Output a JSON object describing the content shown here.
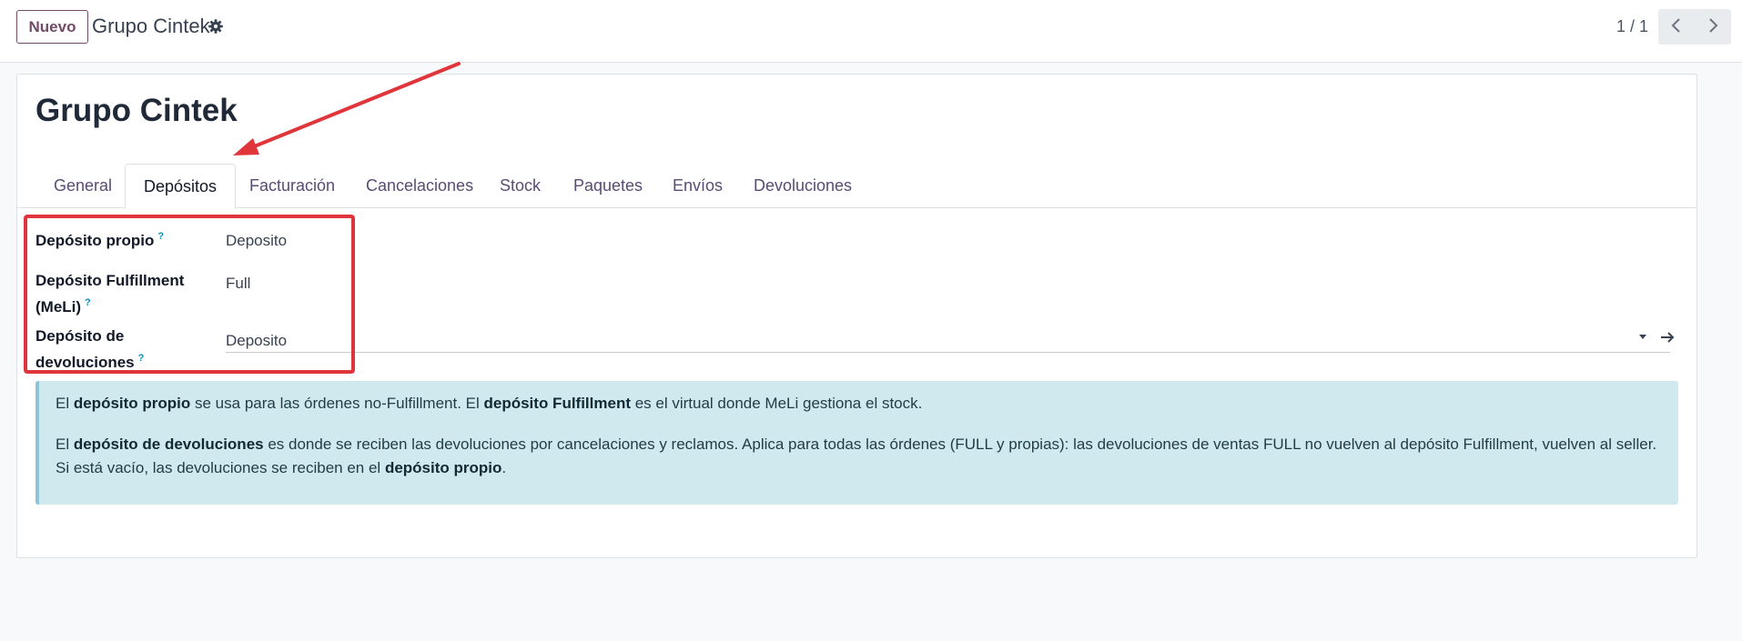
{
  "control_panel": {
    "new_button": "Nuevo",
    "breadcrumb": "Grupo Cintek",
    "pager": "1 / 1"
  },
  "record": {
    "title": "Grupo Cintek"
  },
  "tabs": [
    {
      "label": "General",
      "active": false
    },
    {
      "label": "Depósitos",
      "active": true
    },
    {
      "label": "Facturación",
      "active": false
    },
    {
      "label": "Cancelaciones",
      "active": false
    },
    {
      "label": "Stock",
      "active": false
    },
    {
      "label": "Paquetes",
      "active": false
    },
    {
      "label": "Envíos",
      "active": false
    },
    {
      "label": "Devoluciones",
      "active": false
    }
  ],
  "fields": {
    "own_depot": {
      "label": "Depósito propio",
      "help": "?",
      "value": "Deposito"
    },
    "fulfillment_depot": {
      "label_line1": "Depósito Fulfillment",
      "label_line2": "(MeLi)",
      "help": "?",
      "value": "Full"
    },
    "returns_depot": {
      "label_line1": "Depósito de",
      "label_line2": "devoluciones",
      "help": "?",
      "value": "Deposito"
    }
  },
  "info": {
    "p1": {
      "t1": "El ",
      "b1": "depósito propio",
      "t2": " se usa para las órdenes no-Fulfillment. El ",
      "b2": "depósito Fulfillment",
      "t3": " es el virtual donde MeLi gestiona el stock."
    },
    "p2": {
      "t1": "El ",
      "b1": "depósito de devoluciones",
      "t2": " es donde se reciben las devoluciones por cancelaciones y reclamos. Aplica para todas las órdenes (FULL y propias): las devoluciones de ventas FULL no vuelven al depósito Fulfillment, vuelven al seller. Si está vacío, las devoluciones se reciben en el ",
      "b2": "depósito propio",
      "t3": "."
    }
  },
  "colors": {
    "accent": "#714b67",
    "annotation": "#e0353b",
    "info_bg": "#cfe9ef",
    "help": "#0d8fbd"
  },
  "icons": [
    "gear-icon",
    "chevron-left-icon",
    "chevron-right-icon",
    "caret-down-icon",
    "arrow-right-icon"
  ]
}
